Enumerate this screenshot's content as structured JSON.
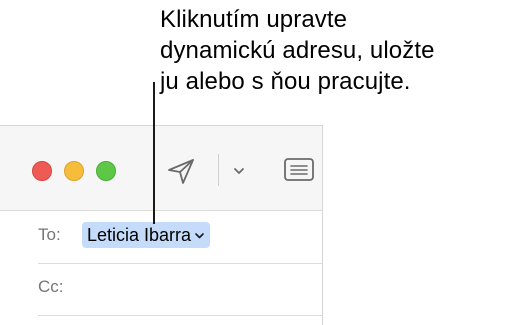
{
  "callout": {
    "lines": [
      "Kliknutím upravte",
      "dynamickú adresu, uložte",
      "ju alebo s ňou pracujte."
    ]
  },
  "window": {
    "traffic_lights": {
      "close_color": "#ee5b55",
      "minimize_color": "#f6bd3b",
      "maximize_color": "#5fc748"
    },
    "toolbar": {
      "icons": [
        "send-icon",
        "chevron-down-icon",
        "header-fields-icon"
      ]
    },
    "to_field": {
      "label": "To:",
      "recipient": "Leticia Ibarra",
      "token_color": "#c4dcfa"
    },
    "cc_field": {
      "label": "Cc:"
    }
  }
}
